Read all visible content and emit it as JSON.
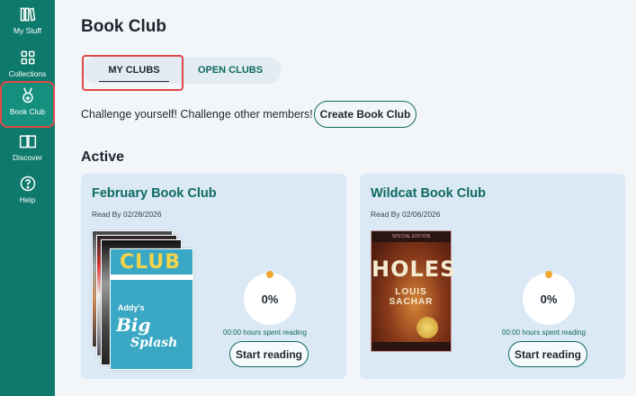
{
  "sidebar": {
    "items": [
      {
        "label": "My Stuff",
        "icon": "books-icon"
      },
      {
        "label": "Collections",
        "icon": "grid-icon"
      },
      {
        "label": "Book Club",
        "icon": "medal-icon",
        "active": true
      },
      {
        "label": "Discover",
        "icon": "open-book-icon"
      },
      {
        "label": "Help",
        "icon": "help-icon"
      }
    ]
  },
  "page": {
    "title": "Book Club",
    "tabs": [
      {
        "label": "MY CLUBS",
        "selected": true
      },
      {
        "label": "OPEN CLUBS",
        "selected": false
      }
    ],
    "challenge_text": "Challenge yourself! Challenge other members!",
    "create_button": "Create Book Club",
    "active_section_title": "Active"
  },
  "clubs": [
    {
      "title": "February Book Club",
      "read_by": "Read By 02/28/2026",
      "progress": "0%",
      "hours": "00:00 hours spent reading",
      "start_label": "Start reading",
      "cover": {
        "club_word": "CLUB",
        "title_top": "Addy's",
        "title_mid": "Big",
        "title_bottom": "Splash"
      }
    },
    {
      "title": "Wildcat Book Club",
      "read_by": "Read By 02/06/2026",
      "progress": "0%",
      "hours": "00:00 hours spent reading",
      "start_label": "Start reading",
      "cover": {
        "edition": "SPECIAL EDITION",
        "title": "HOLES",
        "author": "LOUIS SACHAR"
      }
    }
  ],
  "colors": {
    "sidebar": "#0d7a6b",
    "accent": "#0d6b5f",
    "card": "#dbe8f5",
    "progress_dot": "#f0a830",
    "highlight": "#e04848"
  }
}
